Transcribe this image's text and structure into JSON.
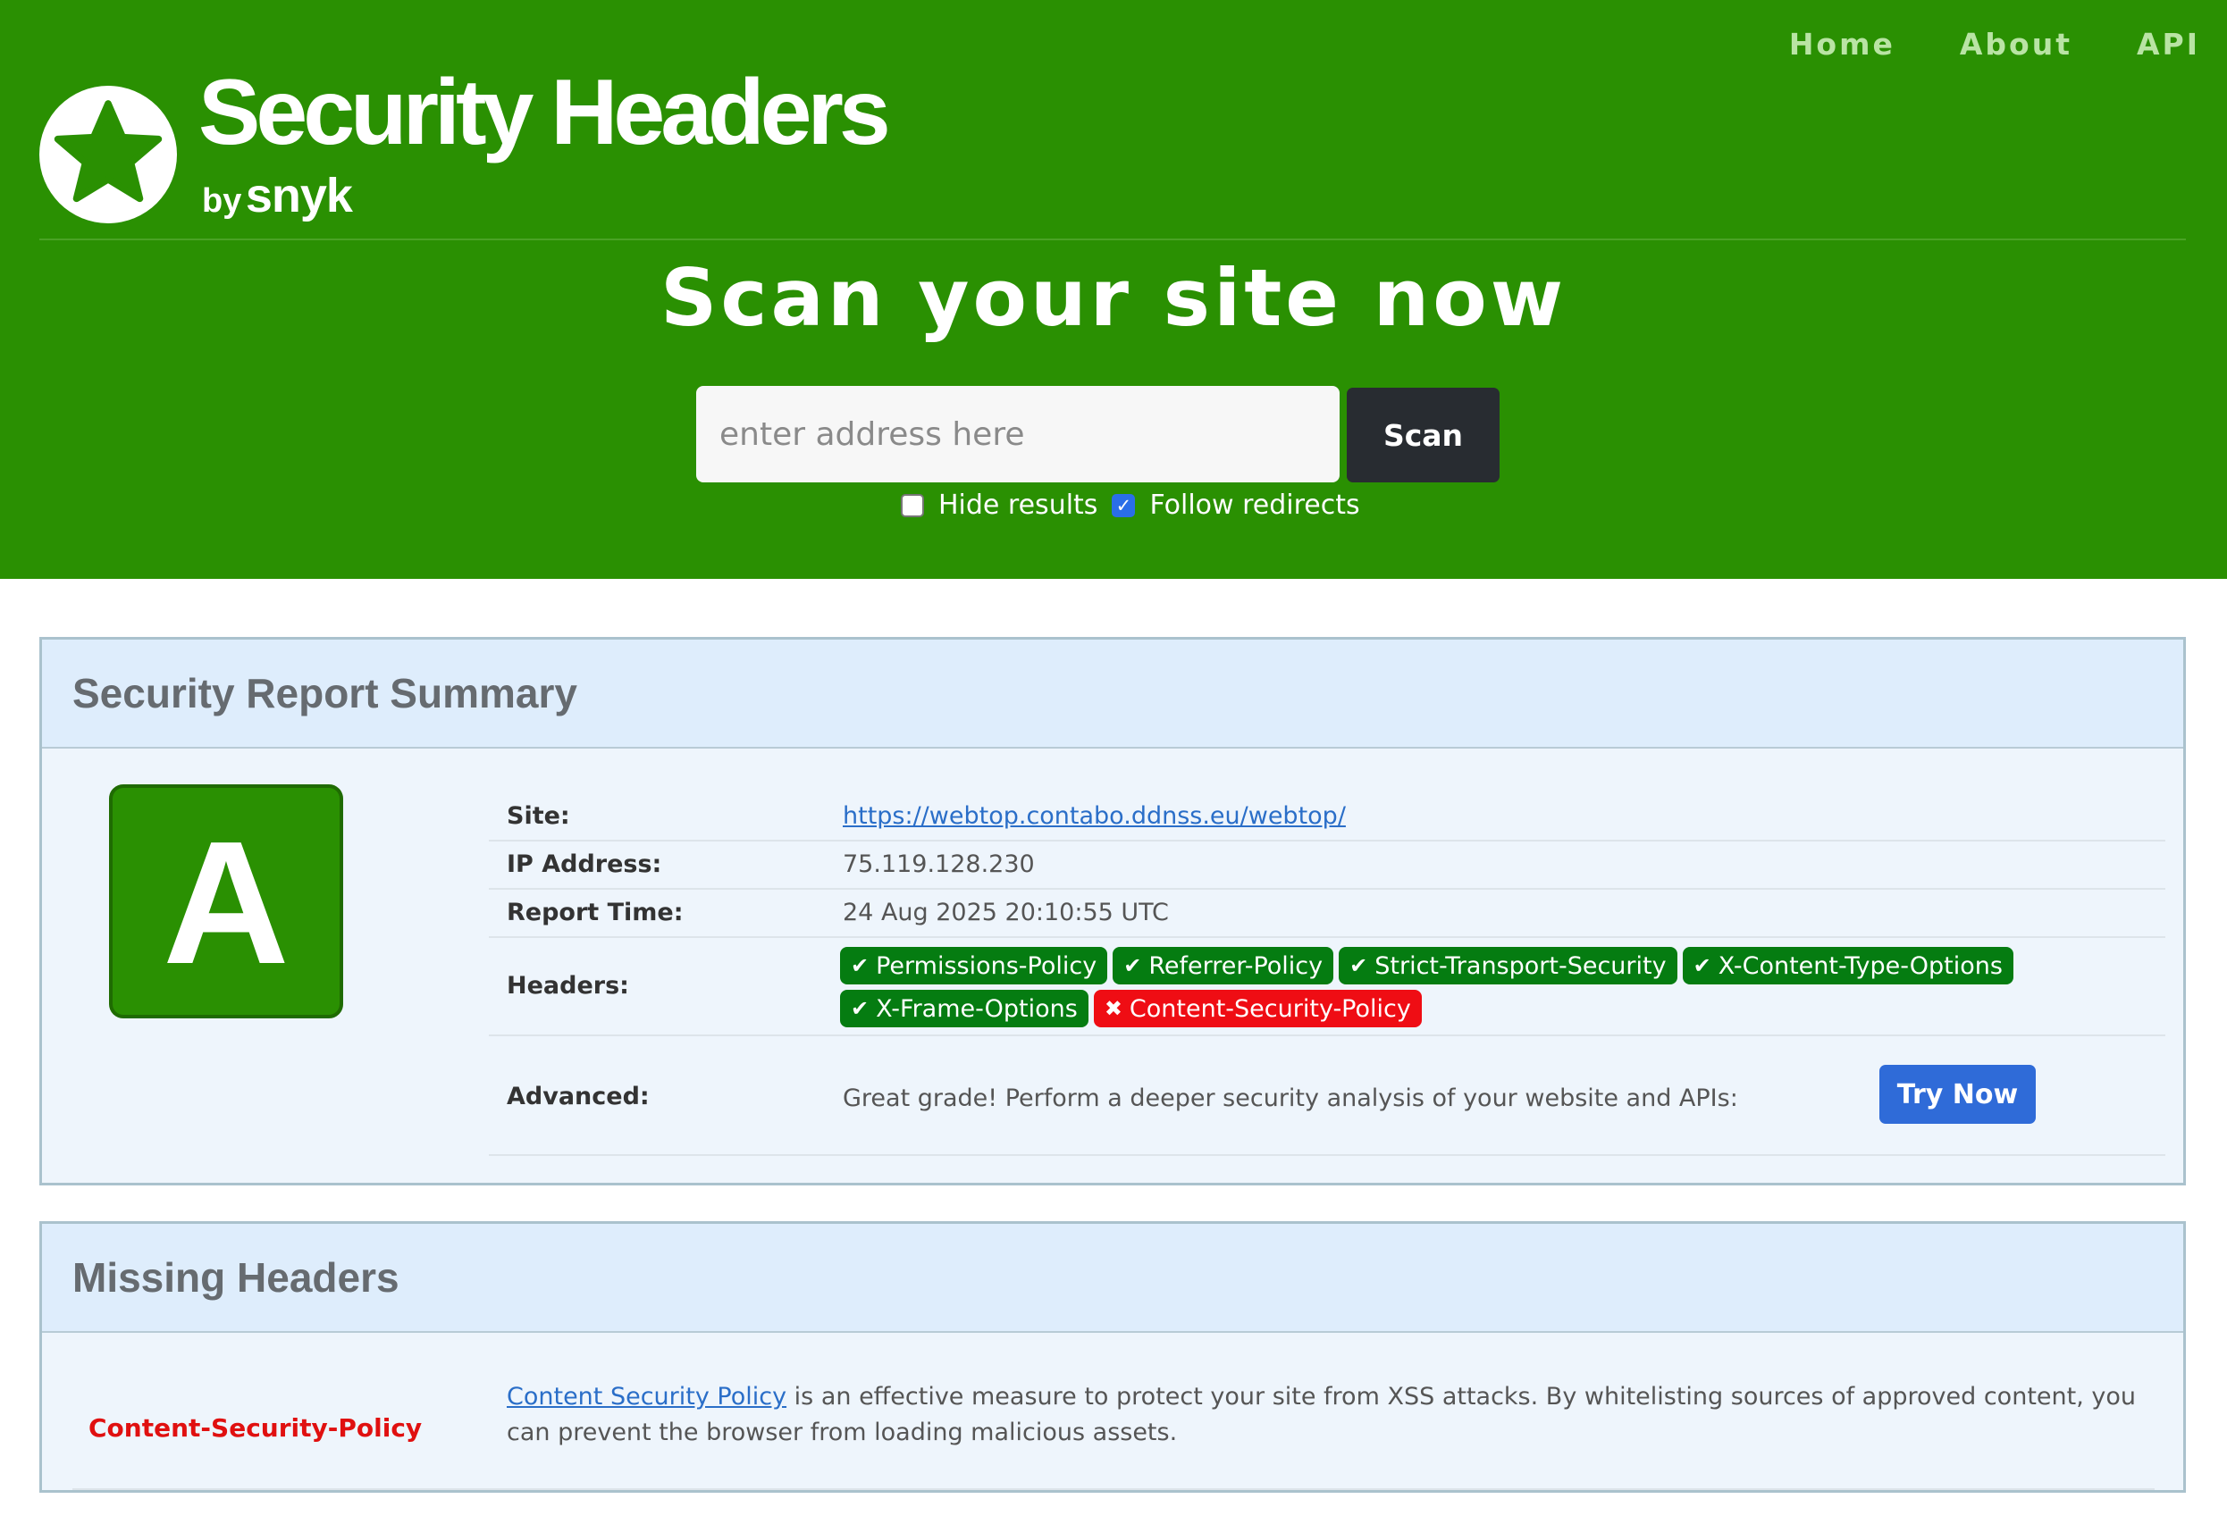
{
  "nav": {
    "items": [
      "Home",
      "About",
      "API"
    ]
  },
  "brand": {
    "title": "Security Headers",
    "by": "by",
    "company": "snyk",
    "icon": "star-icon"
  },
  "hero": {
    "title": "Scan your site now",
    "search_placeholder": "enter address here",
    "search_value": "",
    "scan_label": "Scan",
    "hide_results_label": "Hide results",
    "hide_results_checked": false,
    "follow_redirects_label": "Follow redirects",
    "follow_redirects_checked": true
  },
  "summary": {
    "title": "Security Report Summary",
    "grade": "A",
    "site_label": "Site:",
    "site_value": "https://webtop.contabo.ddnss.eu/webtop/",
    "ip_label": "IP Address:",
    "ip_value": "75.119.128.230",
    "time_label": "Report Time:",
    "time_value": "24 Aug 2025 20:10:55 UTC",
    "headers_label": "Headers:",
    "headers": [
      {
        "name": "Permissions-Policy",
        "status": "present"
      },
      {
        "name": "Referrer-Policy",
        "status": "present"
      },
      {
        "name": "Strict-Transport-Security",
        "status": "present"
      },
      {
        "name": "X-Content-Type-Options",
        "status": "present"
      },
      {
        "name": "X-Frame-Options",
        "status": "present"
      },
      {
        "name": "Content-Security-Policy",
        "status": "missing"
      }
    ],
    "advanced_label": "Advanced:",
    "advanced_text": "Great grade! Perform a deeper security analysis of your website and APIs:",
    "try_label": "Try Now"
  },
  "missing": {
    "title": "Missing Headers",
    "rows": [
      {
        "name": "Content-Security-Policy",
        "link_text": "Content Security Policy",
        "description": " is an effective measure to protect your site from XSS attacks. By whitelisting sources of approved content, you can prevent the browser from loading malicious assets."
      }
    ]
  },
  "colors": {
    "brand_green": "#2a9002",
    "badge_good": "#057c11",
    "badge_bad": "#ef0d14",
    "accent_blue": "#2f6bd8"
  }
}
